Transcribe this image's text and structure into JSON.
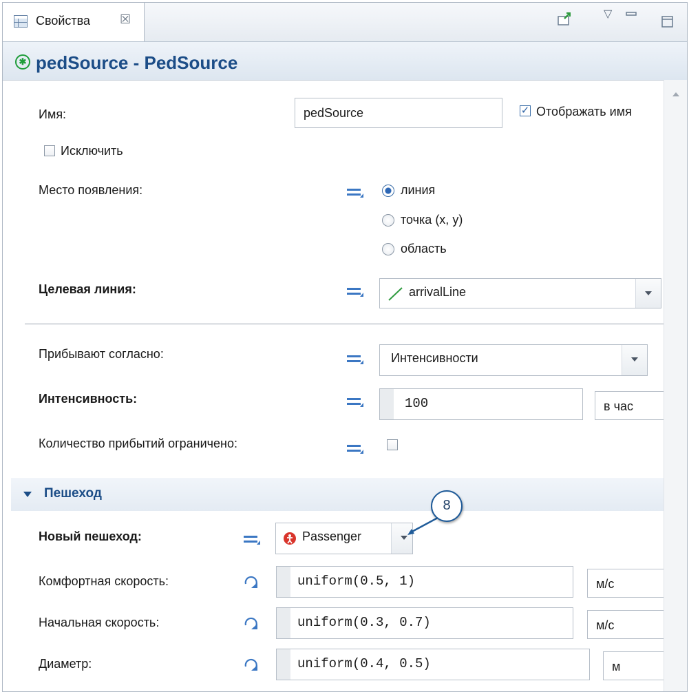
{
  "tab": {
    "title": "Свойства",
    "close_glyph": "☒"
  },
  "header": {
    "title": "pedSource - PedSource",
    "icon": "pedestrian-icon"
  },
  "fields": {
    "name": {
      "label": "Имя:",
      "value": "pedSource",
      "show_name_label": "Отображать имя",
      "show_name_checked": true
    },
    "exclude": {
      "label": "Исключить",
      "checked": false
    },
    "location": {
      "label": "Место появления:",
      "options": [
        "линия",
        "точка (x, y)",
        "область"
      ],
      "selected": "линия"
    },
    "target_line": {
      "label": "Целевая линия:",
      "value": "arrivalLine"
    },
    "arrive_by": {
      "label": "Прибывают согласно:",
      "value": "Интенсивности"
    },
    "intensity": {
      "label": "Интенсивность:",
      "value": "100",
      "unit": "в час"
    },
    "limited": {
      "label": "Количество прибытий ограничено:",
      "checked": false
    }
  },
  "section": {
    "title": "Пешеход"
  },
  "pedestrian": {
    "new_ped": {
      "label": "Новый пешеход:",
      "value": "Passenger"
    },
    "comfort_speed": {
      "label": "Комфортная скорость:",
      "value": "uniform(0.5, 1)",
      "unit": "м/с"
    },
    "initial_speed": {
      "label": "Начальная скорость:",
      "value": "uniform(0.3, 0.7)",
      "unit": "м/с"
    },
    "diameter": {
      "label": "Диаметр:",
      "value": "uniform(0.4, 0.5)",
      "unit": "м"
    }
  },
  "callout": {
    "number": "8"
  },
  "colors": {
    "accent": "#1c4d87",
    "icon_blue": "#3b77c3",
    "ped_red": "#d9342b",
    "line_green": "#2e9a3e"
  }
}
